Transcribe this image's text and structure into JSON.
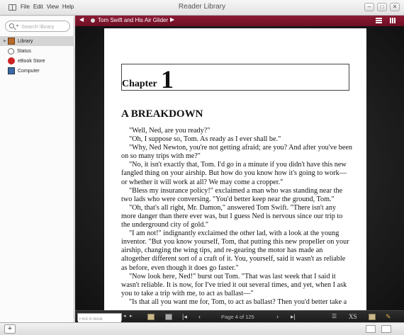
{
  "window": {
    "title": "Reader Library",
    "menus": [
      "File",
      "Edit",
      "View",
      "Help"
    ]
  },
  "sidebar": {
    "search_placeholder": "Search library",
    "items": [
      {
        "label": "Library",
        "icon": "library-icon",
        "selected": true
      },
      {
        "label": "Status",
        "icon": "status-icon",
        "selected": false
      },
      {
        "label": "eBook Store",
        "icon": "ebook-store-icon",
        "selected": false
      },
      {
        "label": "Computer",
        "icon": "computer-icon",
        "selected": false
      }
    ]
  },
  "libbar": {
    "book_title": "Tom Swift and His Air Glider",
    "accent_color": "#7a1530"
  },
  "page": {
    "chapter_label": "Chapter",
    "chapter_number": "1",
    "heading": "A BREAKDOWN",
    "paragraphs": [
      "\"Well, Ned, are you ready?\"",
      "\"Oh, I suppose so, Tom. As ready as I ever shall be.\"",
      "\"Why, Ned Newton, you're not getting afraid; are you? And after you've been on so many trips with me?\"",
      "\"No, it isn't exactly that, Tom. I'd go in a minute if you didn't have this new fangled thing on your airship. But how do you know how it's going to work—or whether it will work at all? We may come a cropper.\"",
      "\"Bless my insurance policy!\" exclaimed a man who was standing near the two lads who were conversing. \"You'd better keep near the ground, Tom.\"",
      "\"Oh, that's all right, Mr. Damon,\" answered Tom Swift. \"There isn't any more danger than there ever was, but I guess Ned is nervous since our trip to the underground city of gold.\"",
      "\"I am not!\" indignantly exclaimed the other lad, with a look at the young inventor. \"But you know yourself, Tom, that putting this new propeller on your airship, changing the wing tips, and re-gearing the motor has made an altogether different sort of a craft of it. You, yourself, said it wasn't as reliable as before, even though it does go faster.\"",
      "\"Now look here, Ned!\" burst out Tom. \"That was last week that I said it wasn't reliable. It is now, for I've tried it out several times, and yet, when I ask you to take a trip with me, to act as ballast—\"",
      "\"Is that all you want me for, Tom, to act as ballast? Then you'd better take a"
    ]
  },
  "reader_toolbar": {
    "find_placeholder": "Find in book",
    "page_indicator": "Page 4 of 125",
    "font_size_label": "XS"
  }
}
